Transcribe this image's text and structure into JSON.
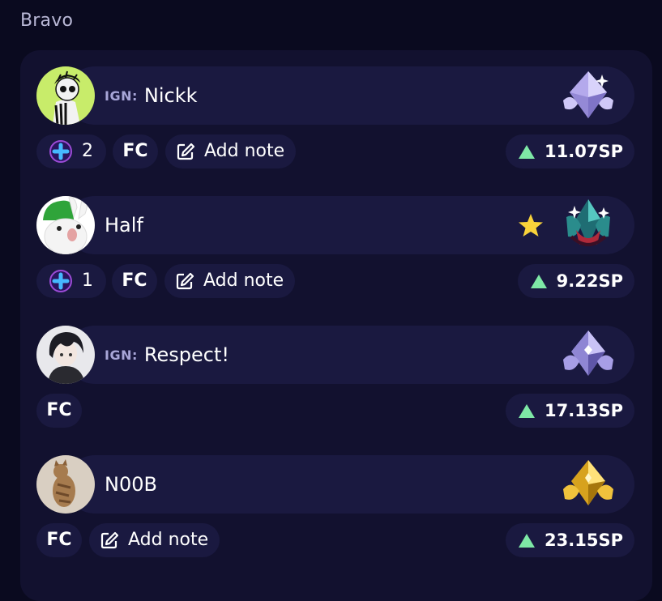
{
  "section": {
    "title": "Bravo"
  },
  "colors": {
    "background": "#0a0a1f",
    "card": "#12112f",
    "pill": "#1a1940",
    "up_arrow": "#7ee8a6",
    "ign_label": "#a8a6d8",
    "star": "#f8d23a",
    "plus": "#46b8ff"
  },
  "players": [
    {
      "ign_label": "IGN:",
      "name": "Nickk",
      "avatar_icon": "avatar-nickk",
      "rank_icon": "diamond-rank-icon",
      "favorite": false,
      "plus_count": "2",
      "fc_label": "FC",
      "note_label": "Add note",
      "sp": "11.07SP"
    },
    {
      "ign_label": "",
      "name": "Half",
      "avatar_icon": "avatar-half",
      "rank_icon": "emerald-rank-icon",
      "favorite": true,
      "plus_count": "1",
      "fc_label": "FC",
      "note_label": "Add note",
      "sp": "9.22SP"
    },
    {
      "ign_label": "IGN:",
      "name": "Respect!",
      "avatar_icon": "avatar-respect",
      "rank_icon": "diamond-rank-icon",
      "favorite": false,
      "plus_count": "",
      "fc_label": "FC",
      "note_label": "",
      "sp": "17.13SP"
    },
    {
      "ign_label": "",
      "name": "N00B",
      "avatar_icon": "avatar-n00b",
      "rank_icon": "gold-rank-icon",
      "favorite": false,
      "plus_count": "",
      "fc_label": "FC",
      "note_label": "Add note",
      "sp": "23.15SP"
    }
  ]
}
